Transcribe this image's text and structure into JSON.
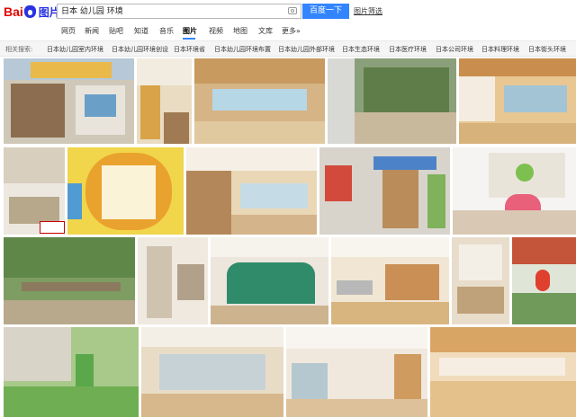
{
  "logo": {
    "text_bai": "Bai",
    "text_tupian": "图片",
    "icon": "paw-icon"
  },
  "search": {
    "query": "日本 幼儿园 环境",
    "button": "百度一下",
    "hint": "图片筛选",
    "camera_icon": "camera-icon"
  },
  "nav": {
    "items": [
      "网页",
      "新闻",
      "贴吧",
      "知道",
      "音乐",
      "图片",
      "视频",
      "地图",
      "文库",
      "更多»"
    ],
    "active": "图片"
  },
  "related": {
    "label": "相关搜索:",
    "items": [
      "日本幼儿园室内环境",
      "日本幼儿园环境创设",
      "日本环境省",
      "日本幼儿园环境布置",
      "日本幼儿园外部环境",
      "日本生态环境",
      "日本医疗环境",
      "日本公司环境",
      "日本料理环境",
      "日本街头环境"
    ]
  },
  "results": {
    "thumbnail_count": 19,
    "watermark": "Fang.com",
    "accent_color": "#3385ff",
    "brand_red": "#e10601",
    "brand_blue": "#2932e1"
  }
}
